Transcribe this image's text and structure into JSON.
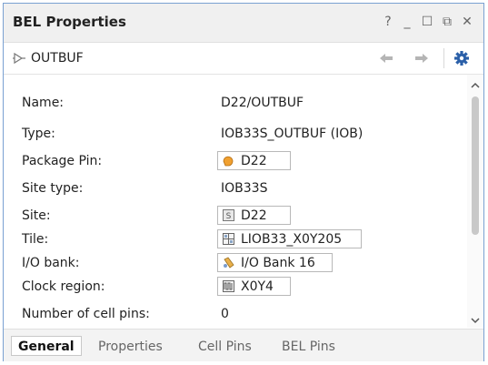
{
  "window": {
    "title": "BEL Properties"
  },
  "window_buttons": {
    "help": "?",
    "minimize": "_",
    "maximize": "☐",
    "float": "⧉",
    "close": "✕"
  },
  "toolbar": {
    "object_name": "OUTBUF"
  },
  "properties": [
    {
      "label": "Name:",
      "value": "D22/OUTBUF"
    },
    {
      "label": "Type:",
      "value": "IOB33S_OUTBUF (IOB)"
    },
    {
      "label": "Package Pin:",
      "value": "D22",
      "icon": "package-pin-icon"
    },
    {
      "label": "Site type:",
      "value": "IOB33S"
    },
    {
      "label": "Site:",
      "value": "D22",
      "icon": "site-icon"
    },
    {
      "label": "Tile:",
      "value": "LIOB33_X0Y205",
      "icon": "tile-icon"
    },
    {
      "label": "I/O bank:",
      "value": "I/O Bank 16",
      "icon": "io-bank-icon"
    },
    {
      "label": "Clock region:",
      "value": "X0Y4",
      "icon": "clock-region-icon"
    },
    {
      "label": "Number of cell pins:",
      "value": "0"
    }
  ],
  "tabs": [
    {
      "label": "General",
      "active": true
    },
    {
      "label": "Properties",
      "active": false
    },
    {
      "label": "Cell Pins",
      "active": false
    },
    {
      "label": "BEL Pins",
      "active": false
    }
  ],
  "colors": {
    "window_border": "#7aa1d2",
    "accent_blue": "#2a5fa8",
    "pin_orange": "#f0a030"
  }
}
